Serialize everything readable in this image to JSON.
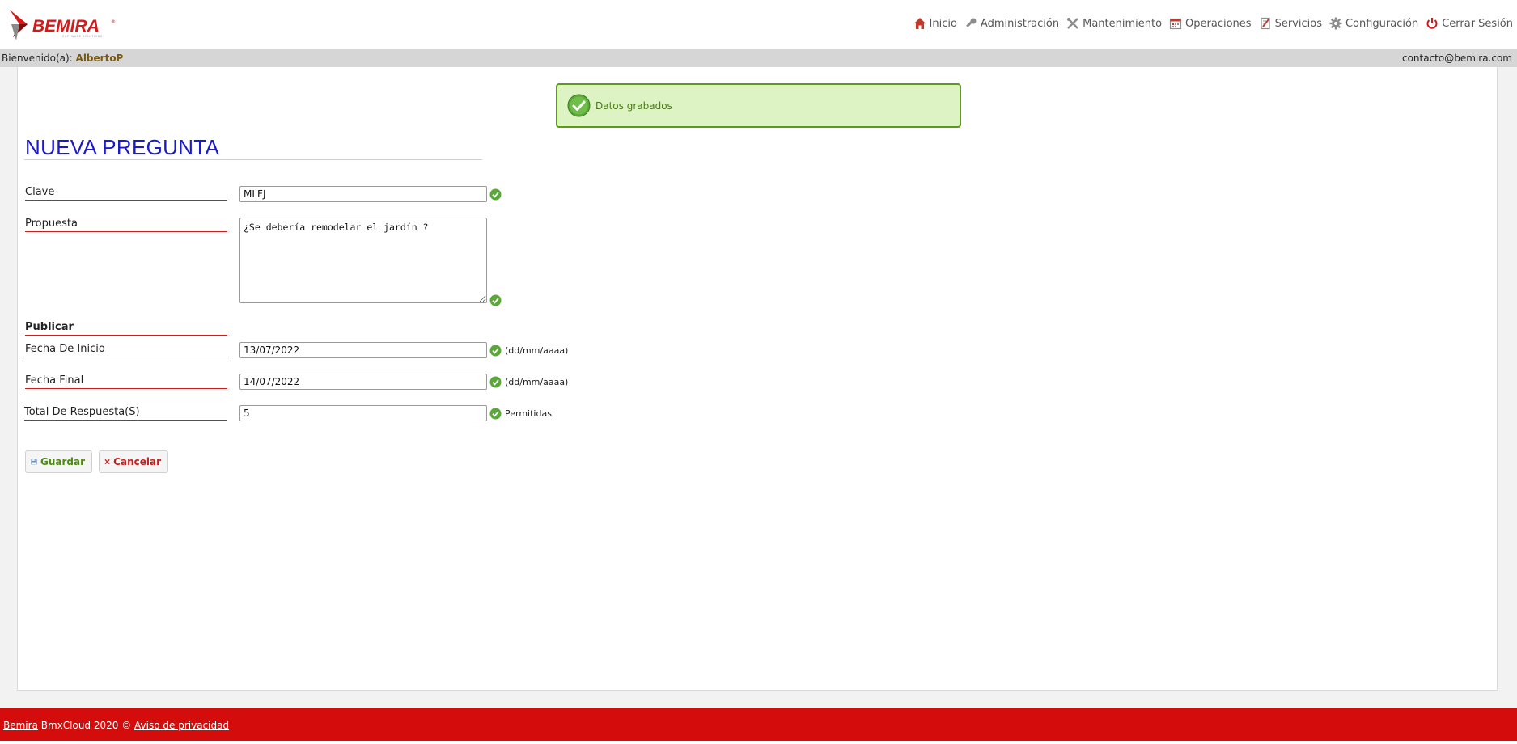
{
  "brand": {
    "name": "BEMIRA",
    "tagline": "SOFTWARE SOLUTIONS",
    "registered": "®",
    "accent": "#d31a1a"
  },
  "nav": [
    {
      "label": "Inicio",
      "icon": "home-icon"
    },
    {
      "label": "Administración",
      "icon": "key-icon"
    },
    {
      "label": "Mantenimiento",
      "icon": "tools-icon"
    },
    {
      "label": "Operaciones",
      "icon": "calendar-icon"
    },
    {
      "label": "Servicios",
      "icon": "services-icon"
    },
    {
      "label": "Configuración",
      "icon": "gear-icon"
    },
    {
      "label": "Cerrar Sesión",
      "icon": "power-icon"
    }
  ],
  "welcome": {
    "prefix": "Bienvenido(a):",
    "user": "AlbertoP",
    "email": "contacto@bemira.com"
  },
  "alert": {
    "message": "Datos grabados",
    "icon": "check-circle-icon"
  },
  "form": {
    "title": "NUEVA PREGUNTA",
    "clave": {
      "label": "Clave",
      "value": "MLFJ"
    },
    "propuesta": {
      "label": "Propuesta",
      "value": "¿Se debería remodelar el jardín ?"
    },
    "publicar": {
      "label": "Publicar"
    },
    "fecha_inicio": {
      "label": "Fecha De Inicio",
      "value": "13/07/2022",
      "hint": "(dd/mm/aaaa)"
    },
    "fecha_final": {
      "label": "Fecha Final",
      "value": "14/07/2022",
      "hint": "(dd/mm/aaaa)"
    },
    "total": {
      "label": "Total De Respuesta(S)",
      "value": "5",
      "hint": "Permitidas"
    }
  },
  "buttons": {
    "save": "Guardar",
    "cancel": "Cancelar"
  },
  "footer": {
    "brand_link": "Bemira",
    "copyright": " BmxCloud 2020 © ",
    "privacy_link": "Aviso de privacidad",
    "background": "#d40c0c"
  }
}
